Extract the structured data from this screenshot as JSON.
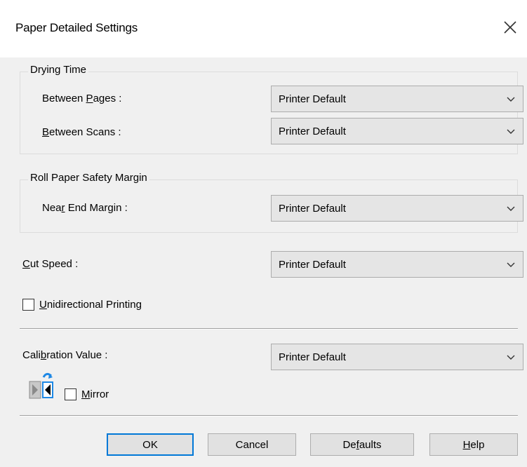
{
  "window": {
    "title": "Paper Detailed Settings",
    "close_icon": "close-icon"
  },
  "drying_time": {
    "group_label": "Drying Time",
    "between_pages": {
      "label_pre": "Between ",
      "label_u": "P",
      "label_post": "ages :",
      "value": "Printer Default"
    },
    "between_scans": {
      "label_pre": "",
      "label_u": "B",
      "label_post": "etween Scans :",
      "value": "Printer Default"
    }
  },
  "roll_paper": {
    "group_label": "Roll Paper Safety Margin",
    "near_end": {
      "label_pre": "Nea",
      "label_u": "r",
      "label_post": " End Margin :",
      "value": "Printer Default"
    }
  },
  "cut_speed": {
    "label_pre": "",
    "label_u": "C",
    "label_post": "ut Speed :",
    "value": "Printer Default"
  },
  "unidirectional": {
    "label_pre": "",
    "label_u": "U",
    "label_post": "nidirectional Printing",
    "checked": false
  },
  "calibration": {
    "label_pre": "Cali",
    "label_u": "b",
    "label_post": "ration Value :",
    "value": "Printer Default"
  },
  "mirror": {
    "label_pre": "",
    "label_u": "M",
    "label_post": "irror",
    "checked": false,
    "icon": "mirror-icon"
  },
  "buttons": {
    "ok": "OK",
    "cancel": "Cancel",
    "defaults_pre": "De",
    "defaults_u": "f",
    "defaults_post": "aults",
    "help_pre": "",
    "help_u": "H",
    "help_post": "elp"
  },
  "colors": {
    "accent": "#0078d7",
    "mirror_icon": "#1e88e5"
  }
}
